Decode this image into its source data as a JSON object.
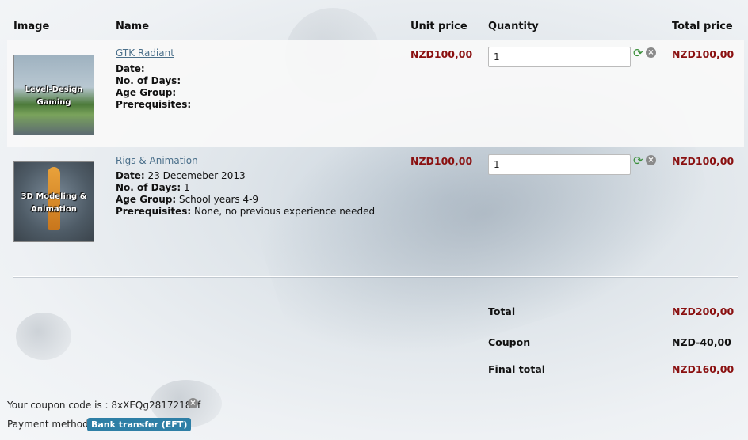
{
  "table": {
    "headers": {
      "image": "Image",
      "name": "Name",
      "unit_price": "Unit price",
      "quantity": "Quantity",
      "total_price": "Total price"
    },
    "items": [
      {
        "name": "GTK Radiant",
        "thumb_text_1": "Level-Design",
        "thumb_text_2": "Gaming",
        "date_label": "Date:",
        "date_value": "",
        "days_label": "No. of Days:",
        "days_value": "",
        "age_label": "Age Group:",
        "age_value": "",
        "prereq_label": "Prerequisites:",
        "prereq_value": "",
        "unit_price": "NZD100,00",
        "quantity": "1",
        "total_price": "NZD100,00"
      },
      {
        "name": "Rigs & Animation",
        "thumb_text_1": "3D Modeling &",
        "thumb_text_2": "Animation",
        "date_label": "Date:",
        "date_value": " 23 Decemeber 2013",
        "days_label": "No. of Days:",
        "days_value": " 1",
        "age_label": "Age Group:",
        "age_value": " School years 4-9",
        "prereq_label": "Prerequisites:",
        "prereq_value": " None, no previous experience needed",
        "unit_price": "NZD100,00",
        "quantity": "1",
        "total_price": "NZD100,00"
      }
    ]
  },
  "summary": {
    "total_label": "Total",
    "total_value": "NZD200,00",
    "coupon_label": "Coupon",
    "coupon_value": "NZD-40,00",
    "final_label": "Final total",
    "final_value": "NZD160,00"
  },
  "footer": {
    "coupon_code_text": "Your coupon code is : 8xXEQg28172185f",
    "payment_label": "Payment method:",
    "payment_method": "Bank transfer (EFT)"
  },
  "icons": {
    "refresh": "refresh-icon",
    "remove": "remove-icon"
  },
  "colors": {
    "price_red": "#8a1010",
    "link_blue": "#4a6f8a",
    "badge_blue": "#2e7fa6"
  }
}
